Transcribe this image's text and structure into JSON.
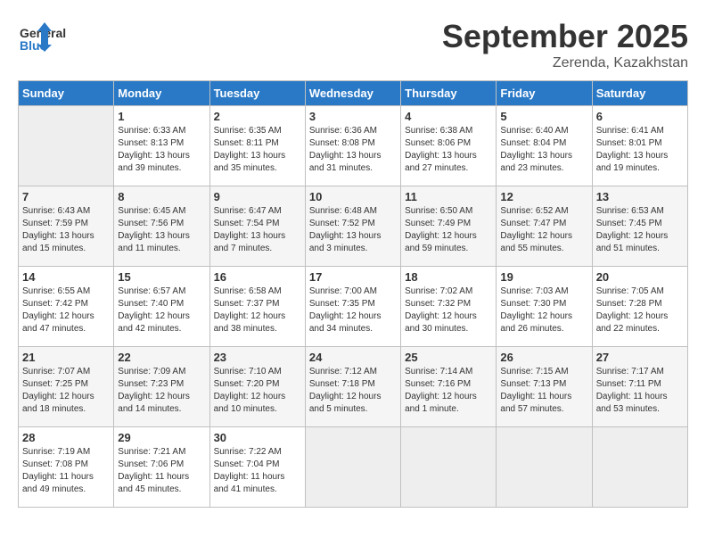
{
  "header": {
    "logo_line1": "General",
    "logo_line2": "Blue",
    "month": "September 2025",
    "location": "Zerenda, Kazakhstan"
  },
  "days_of_week": [
    "Sunday",
    "Monday",
    "Tuesday",
    "Wednesday",
    "Thursday",
    "Friday",
    "Saturday"
  ],
  "weeks": [
    [
      {
        "day": "",
        "sunrise": "",
        "sunset": "",
        "daylight": ""
      },
      {
        "day": "1",
        "sunrise": "Sunrise: 6:33 AM",
        "sunset": "Sunset: 8:13 PM",
        "daylight": "Daylight: 13 hours and 39 minutes."
      },
      {
        "day": "2",
        "sunrise": "Sunrise: 6:35 AM",
        "sunset": "Sunset: 8:11 PM",
        "daylight": "Daylight: 13 hours and 35 minutes."
      },
      {
        "day": "3",
        "sunrise": "Sunrise: 6:36 AM",
        "sunset": "Sunset: 8:08 PM",
        "daylight": "Daylight: 13 hours and 31 minutes."
      },
      {
        "day": "4",
        "sunrise": "Sunrise: 6:38 AM",
        "sunset": "Sunset: 8:06 PM",
        "daylight": "Daylight: 13 hours and 27 minutes."
      },
      {
        "day": "5",
        "sunrise": "Sunrise: 6:40 AM",
        "sunset": "Sunset: 8:04 PM",
        "daylight": "Daylight: 13 hours and 23 minutes."
      },
      {
        "day": "6",
        "sunrise": "Sunrise: 6:41 AM",
        "sunset": "Sunset: 8:01 PM",
        "daylight": "Daylight: 13 hours and 19 minutes."
      }
    ],
    [
      {
        "day": "7",
        "sunrise": "Sunrise: 6:43 AM",
        "sunset": "Sunset: 7:59 PM",
        "daylight": "Daylight: 13 hours and 15 minutes."
      },
      {
        "day": "8",
        "sunrise": "Sunrise: 6:45 AM",
        "sunset": "Sunset: 7:56 PM",
        "daylight": "Daylight: 13 hours and 11 minutes."
      },
      {
        "day": "9",
        "sunrise": "Sunrise: 6:47 AM",
        "sunset": "Sunset: 7:54 PM",
        "daylight": "Daylight: 13 hours and 7 minutes."
      },
      {
        "day": "10",
        "sunrise": "Sunrise: 6:48 AM",
        "sunset": "Sunset: 7:52 PM",
        "daylight": "Daylight: 13 hours and 3 minutes."
      },
      {
        "day": "11",
        "sunrise": "Sunrise: 6:50 AM",
        "sunset": "Sunset: 7:49 PM",
        "daylight": "Daylight: 12 hours and 59 minutes."
      },
      {
        "day": "12",
        "sunrise": "Sunrise: 6:52 AM",
        "sunset": "Sunset: 7:47 PM",
        "daylight": "Daylight: 12 hours and 55 minutes."
      },
      {
        "day": "13",
        "sunrise": "Sunrise: 6:53 AM",
        "sunset": "Sunset: 7:45 PM",
        "daylight": "Daylight: 12 hours and 51 minutes."
      }
    ],
    [
      {
        "day": "14",
        "sunrise": "Sunrise: 6:55 AM",
        "sunset": "Sunset: 7:42 PM",
        "daylight": "Daylight: 12 hours and 47 minutes."
      },
      {
        "day": "15",
        "sunrise": "Sunrise: 6:57 AM",
        "sunset": "Sunset: 7:40 PM",
        "daylight": "Daylight: 12 hours and 42 minutes."
      },
      {
        "day": "16",
        "sunrise": "Sunrise: 6:58 AM",
        "sunset": "Sunset: 7:37 PM",
        "daylight": "Daylight: 12 hours and 38 minutes."
      },
      {
        "day": "17",
        "sunrise": "Sunrise: 7:00 AM",
        "sunset": "Sunset: 7:35 PM",
        "daylight": "Daylight: 12 hours and 34 minutes."
      },
      {
        "day": "18",
        "sunrise": "Sunrise: 7:02 AM",
        "sunset": "Sunset: 7:32 PM",
        "daylight": "Daylight: 12 hours and 30 minutes."
      },
      {
        "day": "19",
        "sunrise": "Sunrise: 7:03 AM",
        "sunset": "Sunset: 7:30 PM",
        "daylight": "Daylight: 12 hours and 26 minutes."
      },
      {
        "day": "20",
        "sunrise": "Sunrise: 7:05 AM",
        "sunset": "Sunset: 7:28 PM",
        "daylight": "Daylight: 12 hours and 22 minutes."
      }
    ],
    [
      {
        "day": "21",
        "sunrise": "Sunrise: 7:07 AM",
        "sunset": "Sunset: 7:25 PM",
        "daylight": "Daylight: 12 hours and 18 minutes."
      },
      {
        "day": "22",
        "sunrise": "Sunrise: 7:09 AM",
        "sunset": "Sunset: 7:23 PM",
        "daylight": "Daylight: 12 hours and 14 minutes."
      },
      {
        "day": "23",
        "sunrise": "Sunrise: 7:10 AM",
        "sunset": "Sunset: 7:20 PM",
        "daylight": "Daylight: 12 hours and 10 minutes."
      },
      {
        "day": "24",
        "sunrise": "Sunrise: 7:12 AM",
        "sunset": "Sunset: 7:18 PM",
        "daylight": "Daylight: 12 hours and 5 minutes."
      },
      {
        "day": "25",
        "sunrise": "Sunrise: 7:14 AM",
        "sunset": "Sunset: 7:16 PM",
        "daylight": "Daylight: 12 hours and 1 minute."
      },
      {
        "day": "26",
        "sunrise": "Sunrise: 7:15 AM",
        "sunset": "Sunset: 7:13 PM",
        "daylight": "Daylight: 11 hours and 57 minutes."
      },
      {
        "day": "27",
        "sunrise": "Sunrise: 7:17 AM",
        "sunset": "Sunset: 7:11 PM",
        "daylight": "Daylight: 11 hours and 53 minutes."
      }
    ],
    [
      {
        "day": "28",
        "sunrise": "Sunrise: 7:19 AM",
        "sunset": "Sunset: 7:08 PM",
        "daylight": "Daylight: 11 hours and 49 minutes."
      },
      {
        "day": "29",
        "sunrise": "Sunrise: 7:21 AM",
        "sunset": "Sunset: 7:06 PM",
        "daylight": "Daylight: 11 hours and 45 minutes."
      },
      {
        "day": "30",
        "sunrise": "Sunrise: 7:22 AM",
        "sunset": "Sunset: 7:04 PM",
        "daylight": "Daylight: 11 hours and 41 minutes."
      },
      {
        "day": "",
        "sunrise": "",
        "sunset": "",
        "daylight": ""
      },
      {
        "day": "",
        "sunrise": "",
        "sunset": "",
        "daylight": ""
      },
      {
        "day": "",
        "sunrise": "",
        "sunset": "",
        "daylight": ""
      },
      {
        "day": "",
        "sunrise": "",
        "sunset": "",
        "daylight": ""
      }
    ]
  ]
}
